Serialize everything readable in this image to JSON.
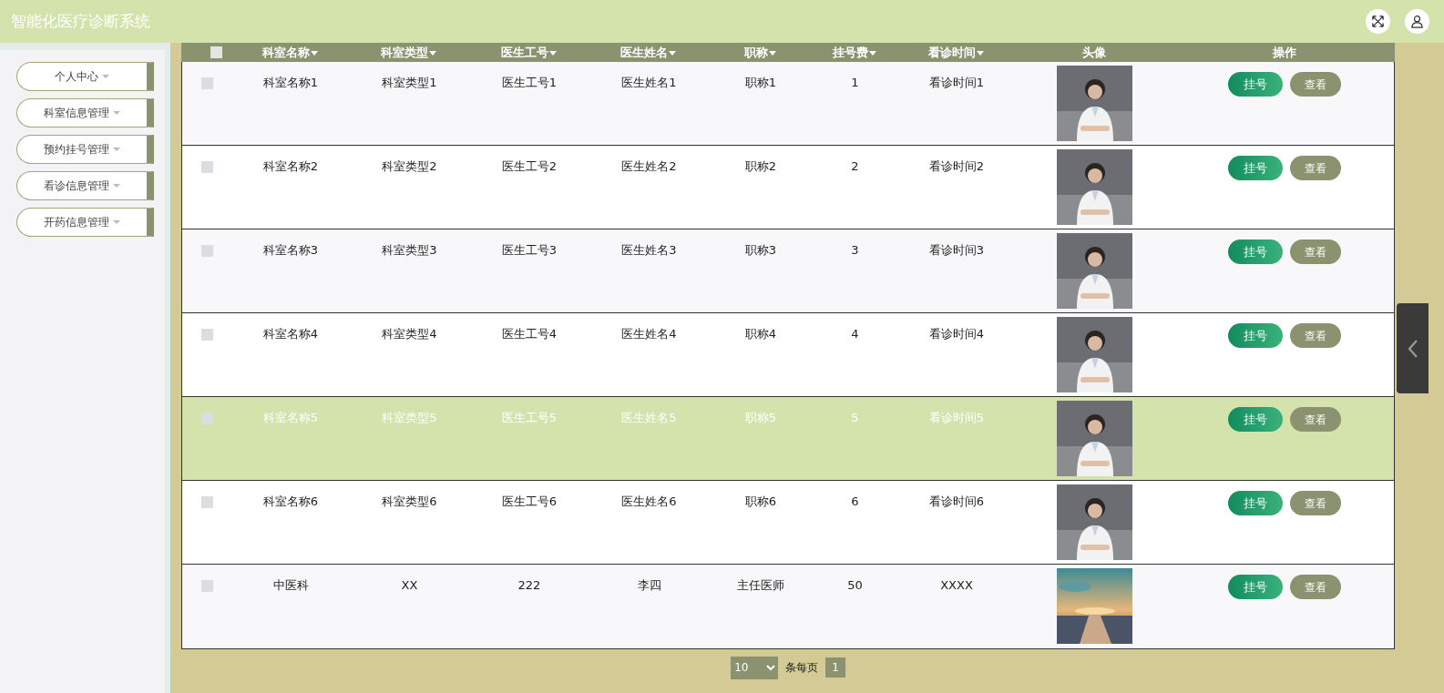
{
  "app_title": "智能化医疗诊断系统",
  "sidebar": {
    "items": [
      {
        "label": "个人中心"
      },
      {
        "label": "科室信息管理"
      },
      {
        "label": "预约挂号管理"
      },
      {
        "label": "看诊信息管理"
      },
      {
        "label": "开药信息管理"
      }
    ]
  },
  "table": {
    "select_all": {
      "checked": false
    },
    "columns": [
      {
        "label": "科室名称",
        "sortable": true
      },
      {
        "label": "科室类型",
        "sortable": true
      },
      {
        "label": "医生工号",
        "sortable": true
      },
      {
        "label": "医生姓名",
        "sortable": true
      },
      {
        "label": "职称",
        "sortable": true
      },
      {
        "label": "挂号费",
        "sortable": true
      },
      {
        "label": "看诊时间",
        "sortable": true
      },
      {
        "label": "头像",
        "sortable": false
      },
      {
        "label": "操作",
        "sortable": false
      }
    ],
    "rows": [
      {
        "cells": [
          "科室名称1",
          "科室类型1",
          "医生工号1",
          "医生姓名1",
          "职称1",
          "1",
          "看诊时间1"
        ],
        "highlighted": false,
        "actions": [
          "挂号",
          "查看"
        ]
      },
      {
        "cells": [
          "科室名称2",
          "科室类型2",
          "医生工号2",
          "医生姓名2",
          "职称2",
          "2",
          "看诊时间2"
        ],
        "highlighted": false,
        "actions": [
          "挂号",
          "查看"
        ]
      },
      {
        "cells": [
          "科室名称3",
          "科室类型3",
          "医生工号3",
          "医生姓名3",
          "职称3",
          "3",
          "看诊时间3"
        ],
        "highlighted": false,
        "actions": [
          "挂号",
          "查看"
        ]
      },
      {
        "cells": [
          "科室名称4",
          "科室类型4",
          "医生工号4",
          "医生姓名4",
          "职称4",
          "4",
          "看诊时间4"
        ],
        "highlighted": false,
        "actions": [
          "挂号",
          "查看"
        ]
      },
      {
        "cells": [
          "科室名称5",
          "科室类型5",
          "医生工号5",
          "医生姓名5",
          "职称5",
          "5",
          "看诊时间5"
        ],
        "highlighted": true,
        "actions": [
          "挂号",
          "查看"
        ]
      },
      {
        "cells": [
          "科室名称6",
          "科室类型6",
          "医生工号6",
          "医生姓名6",
          "职称6",
          "6",
          "看诊时间6"
        ],
        "highlighted": false,
        "actions": [
          "挂号",
          "查看"
        ]
      },
      {
        "cells": [
          "中医科",
          "XX",
          "222",
          "李四",
          "主任医师",
          "50",
          "XXXX"
        ],
        "highlighted": false,
        "actions": [
          "挂号",
          "查看"
        ]
      }
    ]
  },
  "pagination": {
    "page_size": "10",
    "page_size_label": "条每页",
    "pages": [
      {
        "label": "1",
        "selected": true
      }
    ]
  }
}
